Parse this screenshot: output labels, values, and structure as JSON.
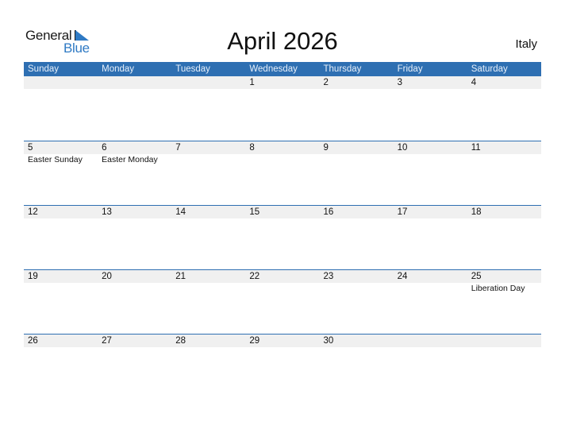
{
  "logo": {
    "line1": "General",
    "line2": "Blue"
  },
  "title": "April 2026",
  "country": "Italy",
  "colors": {
    "accent": "#2e6fb2",
    "strip": "#f0f0f0",
    "logo_blue": "#2f7ac4"
  },
  "days": [
    "Sunday",
    "Monday",
    "Tuesday",
    "Wednesday",
    "Thursday",
    "Friday",
    "Saturday"
  ],
  "weeks": [
    {
      "dates": [
        "",
        "",
        "",
        "1",
        "2",
        "3",
        "4"
      ],
      "events": [
        "",
        "",
        "",
        "",
        "",
        "",
        ""
      ]
    },
    {
      "dates": [
        "5",
        "6",
        "7",
        "8",
        "9",
        "10",
        "11"
      ],
      "events": [
        "Easter Sunday",
        "Easter Monday",
        "",
        "",
        "",
        "",
        ""
      ]
    },
    {
      "dates": [
        "12",
        "13",
        "14",
        "15",
        "16",
        "17",
        "18"
      ],
      "events": [
        "",
        "",
        "",
        "",
        "",
        "",
        ""
      ]
    },
    {
      "dates": [
        "19",
        "20",
        "21",
        "22",
        "23",
        "24",
        "25"
      ],
      "events": [
        "",
        "",
        "",
        "",
        "",
        "",
        "Liberation Day"
      ]
    },
    {
      "dates": [
        "26",
        "27",
        "28",
        "29",
        "30",
        "",
        ""
      ],
      "events": [
        "",
        "",
        "",
        "",
        "",
        "",
        ""
      ]
    }
  ]
}
